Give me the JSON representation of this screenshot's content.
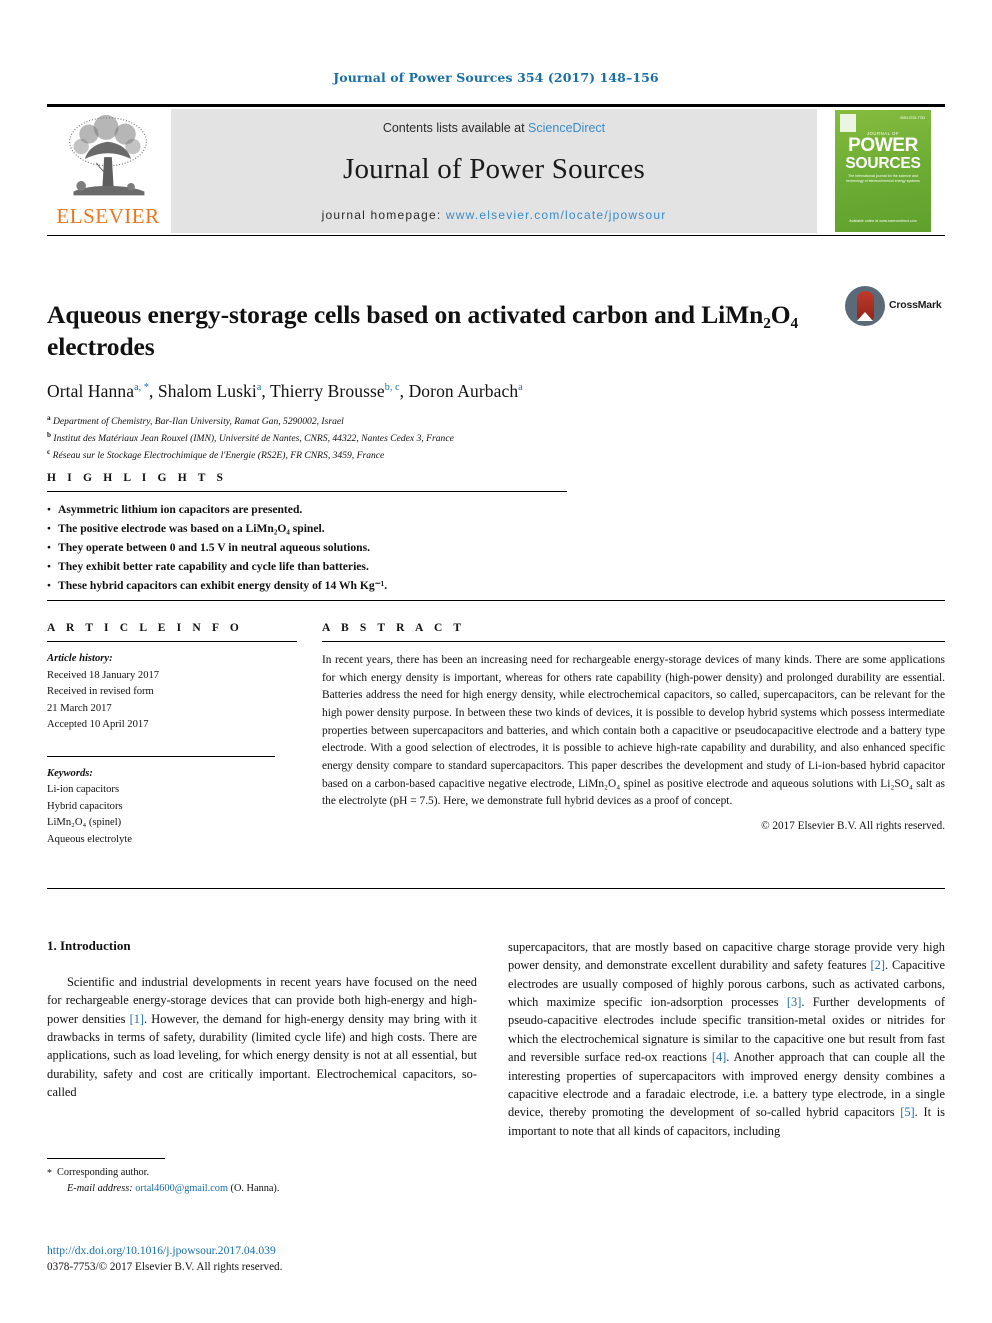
{
  "running_head": "Journal of Power Sources 354 (2017) 148–156",
  "masthead": {
    "publisher_name": "ELSEVIER",
    "contents_prefix": "Contents lists available at ",
    "contents_link": "ScienceDirect",
    "journal_title": "Journal of Power Sources",
    "homepage_prefix": "journal homepage: ",
    "homepage_url": "www.elsevier.com/locate/jpowsour",
    "cover": {
      "supra": "JOURNAL OF",
      "line1": "POWER",
      "line2": "SOURCES",
      "subtitle": "The international journal for the science and technology of electrochemical energy systems",
      "footer": "Available online at www.sciencedirect.com",
      "issn": "ISSN 0378-7753"
    }
  },
  "article": {
    "title": "Aqueous energy-storage cells based on activated carbon and LiMn₂O₄ electrodes",
    "crossmark_label": "CrossMark",
    "authors": [
      {
        "name": "Ortal Hanna",
        "marks": "a, *"
      },
      {
        "name": "Shalom Luski",
        "marks": "a"
      },
      {
        "name": "Thierry Brousse",
        "marks": "b, c"
      },
      {
        "name": "Doron Aurbach",
        "marks": "a"
      }
    ],
    "affiliations": [
      {
        "mark": "a",
        "text": "Department of Chemistry, Bar-Ilan University, Ramat Gan, 5290002, Israel"
      },
      {
        "mark": "b",
        "text": "Institut des Matériaux Jean Rouxel (IMN), Université de Nantes, CNRS, 44322, Nantes Cedex 3, France"
      },
      {
        "mark": "c",
        "text": "Réseau sur le Stockage Electrochimique de l'Energie (RS2E), FR CNRS, 3459, France"
      }
    ]
  },
  "highlights": {
    "heading": "H I G H L I G H T S",
    "items": [
      "Asymmetric lithium ion capacitors are presented.",
      "The positive electrode was based on a LiMn₂O₄ spinel.",
      "They operate between 0 and 1.5 V in neutral aqueous solutions.",
      "They exhibit better rate capability and cycle life than batteries.",
      "These hybrid capacitors can exhibit energy density of 14 Wh Kg⁻¹."
    ]
  },
  "article_info": {
    "heading": "A R T I C L E   I N F O",
    "history_label": "Article history:",
    "history": [
      "Received 18 January 2017",
      "Received in revised form",
      "21 March 2017",
      "Accepted 10 April 2017"
    ],
    "keywords_label": "Keywords:",
    "keywords": [
      "Li-ion capacitors",
      "Hybrid capacitors",
      "LiMn₂O₄ (spinel)",
      "Aqueous electrolyte"
    ]
  },
  "abstract": {
    "heading": "A B S T R A C T",
    "text": "In recent years, there has been an increasing need for rechargeable energy-storage devices of many kinds. There are some applications for which energy density is important, whereas for others rate capability (high-power density) and prolonged durability are essential. Batteries address the need for high energy density, while electrochemical capacitors, so called, supercapacitors, can be relevant for the high power density purpose. In between these two kinds of devices, it is possible to develop hybrid systems which possess intermediate properties between supercapacitors and batteries, and which contain both a capacitive or pseudocapacitive electrode and a battery type electrode. With a good selection of electrodes, it is possible to achieve high-rate capability and durability, and also enhanced specific energy density compare to standard supercapacitors. This paper describes the development and study of Li-ion-based hybrid capacitor based on a carbon-based capacitive negative electrode, LiMn₂O₄ spinel as positive electrode and aqueous solutions with Li₂SO₄ salt as the electrolyte (pH = 7.5). Here, we demonstrate full hybrid devices as a proof of concept.",
    "copyright": "© 2017 Elsevier B.V. All rights reserved."
  },
  "body": {
    "section_title": "1. Introduction",
    "left_paragraph_parts": [
      "Scientific and industrial developments in recent years have focused on the need for rechargeable energy-storage devices that can provide both high-energy and high-power densities ",
      "[1]",
      ". However, the demand for high-energy density may bring with it drawbacks in terms of safety, durability (limited cycle life) and high costs. There are applications, such as load leveling, for which energy density is not at all essential, but durability, safety and cost are critically important. Electrochemical capacitors, so-called"
    ],
    "right_paragraph_parts": [
      "supercapacitors, that are mostly based on capacitive charge storage provide very high power density, and demonstrate excellent durability and safety features ",
      "[2]",
      ". Capacitive electrodes are usually composed of highly porous carbons, such as activated carbons, which maximize specific ion-adsorption processes ",
      "[3]",
      ". Further developments of pseudo-capacitive electrodes include specific transition-metal oxides or nitrides for which the electrochemical signature is similar to the capacitive one but result from fast and reversible surface red-ox reactions ",
      "[4]",
      ". Another approach that can couple all the interesting properties of supercapacitors with improved energy density combines a capacitive electrode and a faradaic electrode, i.e. a battery type electrode, in a single device, thereby promoting the development of so-called hybrid capacitors ",
      "[5]",
      ". It is important to note that all kinds of capacitors, including"
    ]
  },
  "footnote": {
    "corresponding": "Corresponding author.",
    "email_label": "E-mail address:",
    "email": "ortal4600@gmail.com",
    "email_suffix": "(O. Hanna)."
  },
  "footer": {
    "doi": "http://dx.doi.org/10.1016/j.jpowsour.2017.04.039",
    "issn_line": "0378-7753/© 2017 Elsevier B.V. All rights reserved."
  },
  "colors": {
    "link_blue": "#1a6ea8",
    "sciencedirect_blue": "#3a8cc8",
    "elsevier_orange": "#e87722",
    "cover_green": "#6fae35",
    "band_grey": "#e3e3e3"
  }
}
